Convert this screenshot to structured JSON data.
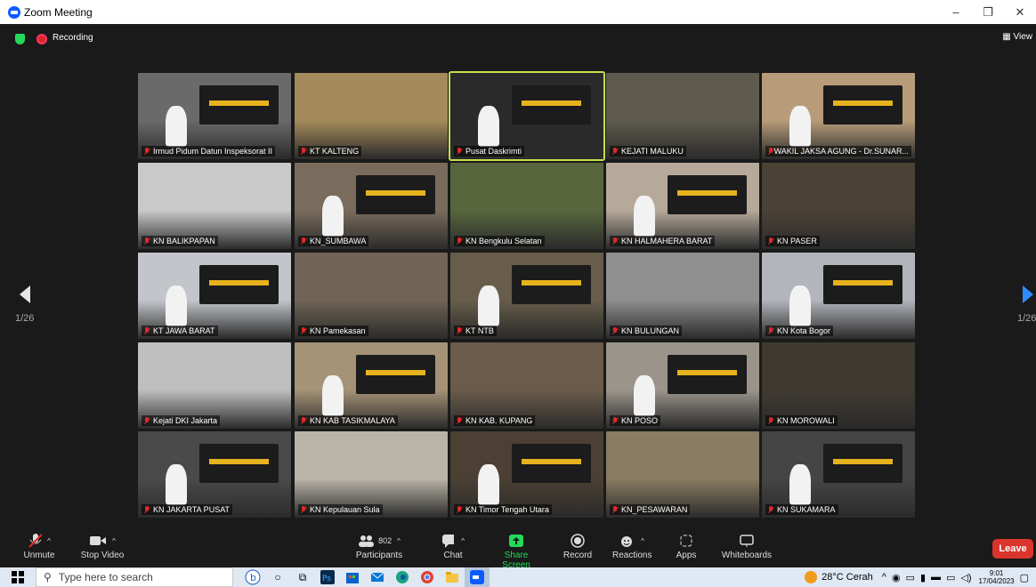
{
  "window": {
    "title": "Zoom Meeting",
    "minimize": "–",
    "restore": "❐",
    "close": "✕"
  },
  "meeting": {
    "recording_label": "Recording",
    "view_label": "View",
    "page_left": "1/26",
    "page_right": "1/26"
  },
  "participants": [
    {
      "name": "Irmud Pidum Datun Inspeksorat II",
      "scene": "#6a6a6a"
    },
    {
      "name": "KT KALTENG",
      "scene": "#a58a5b"
    },
    {
      "name": "Pusat Daskrimti",
      "scene": "#2a2a2a",
      "active": true
    },
    {
      "name": "KEJATI MALUKU",
      "scene": "#5e5a4e"
    },
    {
      "name": "WAKIL JAKSA AGUNG - Dr.SUNAR...",
      "scene": "#b89c79"
    },
    {
      "name": "KN BALIKPAPAN",
      "scene": "#c9c9c9"
    },
    {
      "name": "KN_SUMBAWA",
      "scene": "#7a6c5c"
    },
    {
      "name": "KN Bengkulu Selatan",
      "scene": "#58663d"
    },
    {
      "name": "KN HALMAHERA BARAT",
      "scene": "#b6a99a"
    },
    {
      "name": "KN PASER",
      "scene": "#4b4236"
    },
    {
      "name": "KT JAWA BARAT",
      "scene": "#c2c6cb"
    },
    {
      "name": "KN Pamekasan",
      "scene": "#6f6455"
    },
    {
      "name": "KT NTB",
      "scene": "#675d4a"
    },
    {
      "name": "KN BULUNGAN",
      "scene": "#8f8f8f"
    },
    {
      "name": "KN Kota Bogor",
      "scene": "#b2b6bc"
    },
    {
      "name": "Kejati DKI Jakarta",
      "scene": "#bfbfbf"
    },
    {
      "name": "KN KAB TASIKMALAYA",
      "scene": "#a59277"
    },
    {
      "name": "KN KAB. KUPANG",
      "scene": "#6a5b4a"
    },
    {
      "name": "KN POSO",
      "scene": "#9a948b"
    },
    {
      "name": "KN MOROWALI",
      "scene": "#3f3a31"
    },
    {
      "name": "KN JAKARTA PUSAT",
      "scene": "#4a4a4a"
    },
    {
      "name": "KN Kepulauan Sula",
      "scene": "#b9b4a8"
    },
    {
      "name": "KN Timor Tengah Utara",
      "scene": "#4b4033"
    },
    {
      "name": "KN_PESAWARAN",
      "scene": "#8a7c62"
    },
    {
      "name": "KN SUKAMARA",
      "scene": "#454545"
    }
  ],
  "toolbar": {
    "unmute": "Unmute",
    "stop_video": "Stop Video",
    "participants": "Participants",
    "participants_count": "802",
    "chat": "Chat",
    "share_screen": "Share Screen",
    "record": "Record",
    "reactions": "Reactions",
    "apps": "Apps",
    "whiteboards": "Whiteboards",
    "leave": "Leave"
  },
  "taskbar": {
    "search_placeholder": "Type here to search",
    "weather": "28°C Cerah",
    "time": "9:01",
    "date": "17/04/2023"
  },
  "colors": {
    "accent_green": "#23d959",
    "leave_red": "#d9352c",
    "zoom_blue": "#0b5cff",
    "active_border": "#c5e04a"
  }
}
